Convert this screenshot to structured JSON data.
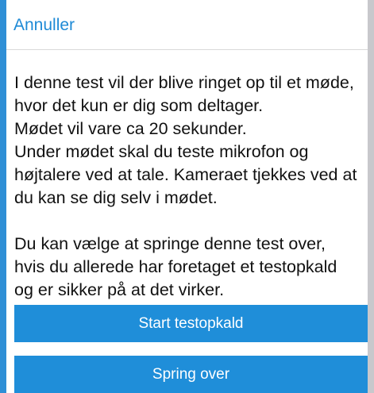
{
  "nav": {
    "cancel_label": "Annuller"
  },
  "content": {
    "lines_p1": [
      "I denne test vil der blive ringet op til et møde,",
      "hvor det kun er dig som deltager.",
      "Mødet vil vare ca 20 sekunder.",
      "Under mødet skal du teste mikrofon og",
      "højtalere ved at tale. Kameraet tjekkes ved at",
      "du kan se dig selv i mødet."
    ],
    "lines_p2": [
      "Du kan vælge at springe denne test over,",
      "hvis du allerede har foretaget et testopkald",
      "og er sikker på at det virker."
    ]
  },
  "buttons": {
    "start_label": "Start testopkald",
    "skip_label": "Spring over"
  },
  "colors": {
    "accent": "#1f8ed9",
    "text": "#111111",
    "divider": "#d9d9d9"
  }
}
